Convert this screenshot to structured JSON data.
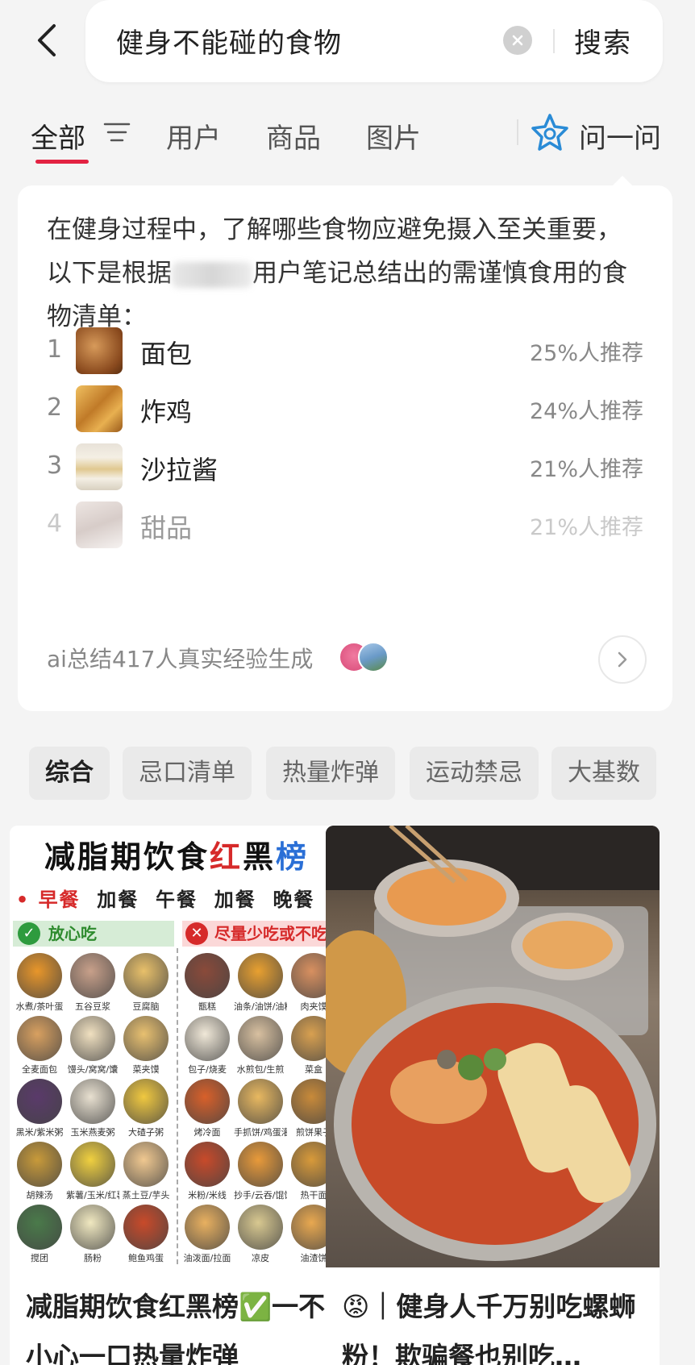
{
  "search": {
    "query": "健身不能碰的食物",
    "button": "搜索"
  },
  "tabs": [
    {
      "label": "全部",
      "active": true
    },
    {
      "label": "用户",
      "active": false
    },
    {
      "label": "商品",
      "active": false
    },
    {
      "label": "图片",
      "active": false
    }
  ],
  "ask": {
    "label": "问一问"
  },
  "ai_summary": {
    "intro_part1": "在健身过程中，了解哪些食物应避免摄入至关重要，以下是根据",
    "intro_part2": "用户笔记总结出的需谨慎食用的食物清单：",
    "foods": [
      {
        "rank": "1",
        "name": "面包",
        "pct": "25%人推荐"
      },
      {
        "rank": "2",
        "name": "炸鸡",
        "pct": "24%人推荐"
      },
      {
        "rank": "3",
        "name": "沙拉酱",
        "pct": "21%人推荐"
      },
      {
        "rank": "4",
        "name": "甜品",
        "pct": "21%人推荐"
      }
    ],
    "footer": "ai总结417人真实经验生成"
  },
  "chips": [
    {
      "label": "综合",
      "active": true
    },
    {
      "label": "忌口清单",
      "active": false
    },
    {
      "label": "热量炸弹",
      "active": false
    },
    {
      "label": "运动禁忌",
      "active": false
    },
    {
      "label": "大基数",
      "active": false
    }
  ],
  "feed": [
    {
      "title": "减脂期饮食红黑榜✅一不小心一口热量炸弹",
      "poster": {
        "title_a": "减脂期饮食",
        "title_b": "红",
        "title_c": "黑",
        "title_d": "榜",
        "meals": [
          "早餐",
          "加餐",
          "午餐",
          "加餐",
          "晚餐"
        ],
        "ok_label": "放心吃",
        "no_label": "尽量少吃或不吃",
        "ok_foods": [
          "水煮/茶叶蛋",
          "五谷豆浆",
          "豆腐脑",
          "全麦面包",
          "馒头/窝窝/馕",
          "菜夹馍",
          "黑米/紫米粥",
          "玉米燕麦粥",
          "大碴子粥",
          "胡辣汤",
          "紫薯/玉米/红薯",
          "蒸土豆/芋头",
          "搅团",
          "肠粉",
          "鲍鱼鸡蛋"
        ],
        "no_foods": [
          "甑糕",
          "油条/油饼/油糕",
          "肉夹馍",
          "包子/烧麦",
          "水煎包/生煎",
          "菜盒",
          "烤冷面",
          "手抓饼/鸡蛋灌饼",
          "煎饼果子",
          "米粉/米线",
          "抄手/云吞/馄饨",
          "热干面",
          "油泼面/拉面",
          "凉皮",
          "油渣饼"
        ]
      }
    },
    {
      "title": "😡｜健身人千万别吃螺蛳粉！欺骗餐也别吃…"
    }
  ],
  "colors": {
    "accent": "#e32242",
    "blue": "#2a6fd6",
    "green": "#2e8b2e",
    "red": "#d62a2a"
  }
}
